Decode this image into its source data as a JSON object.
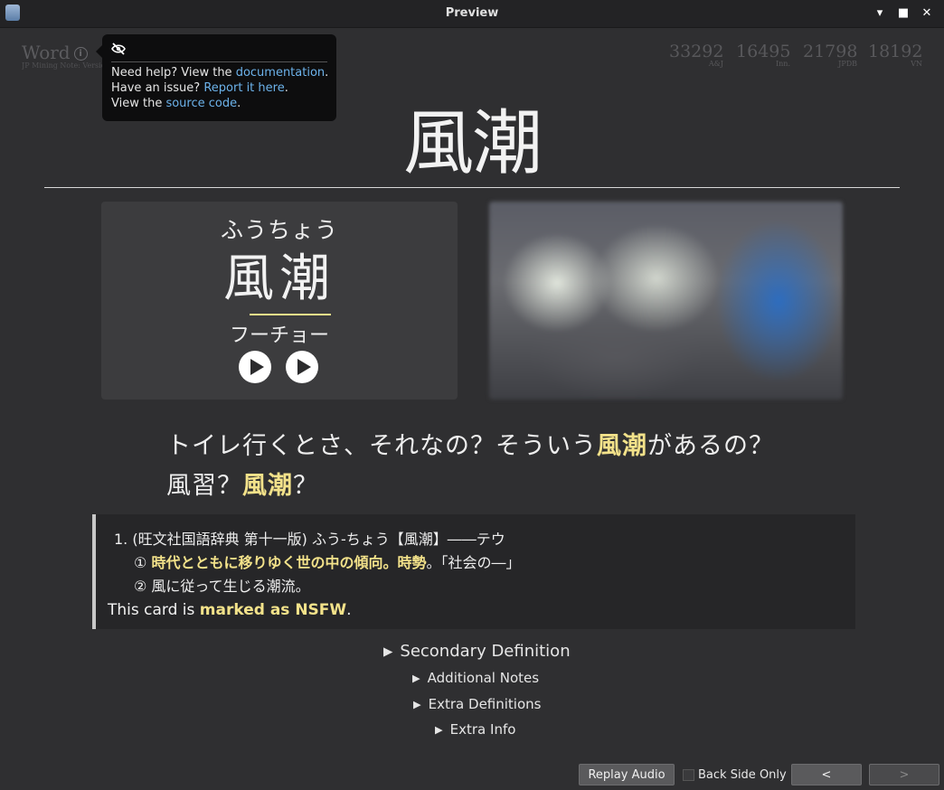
{
  "window": {
    "title": "Preview",
    "controls": [
      "▾",
      "■",
      "✕"
    ]
  },
  "card_header": {
    "word_label": "Word",
    "note_type": "JP Mining Note: Version",
    "tooltip": {
      "line1_prefix": "Need help? View the ",
      "line1_link": "documentation",
      "line1_suffix": ".",
      "line2_prefix": "Have an issue? ",
      "line2_link": "Report it here",
      "line2_suffix": ".",
      "line3_prefix": "View the ",
      "line3_link": "source code",
      "line3_suffix": "."
    },
    "frequencies": [
      {
        "value": "33292",
        "label": "A&J"
      },
      {
        "value": "16495",
        "label": "Inn."
      },
      {
        "value": "21798",
        "label": "JPDB"
      },
      {
        "value": "18192",
        "label": "VN"
      }
    ]
  },
  "word": "風潮",
  "reading": {
    "furigana": "ふうちょう",
    "kanji": "風潮",
    "kana": "フーチョー"
  },
  "sentence": {
    "line1_a": "トイレ行くとさ、それなの？そういう",
    "line1_hl": "風潮",
    "line1_b": "があるの？",
    "line2_a": "風習？",
    "line2_hl": "風潮",
    "line2_b": "？"
  },
  "definition": {
    "header": "1. (旺文社国語辞典 第十一版) ふう‐ちょう【風潮】――テウ",
    "sense1_num": "①",
    "sense1_hl": "時代とともに移りゆく世の中の傾向。時勢",
    "sense1_rest": "。「社会の―」",
    "sense2": "② 風に従って生じる潮流。",
    "nsfw_prefix": "This card is ",
    "nsfw_bold": "marked as NSFW",
    "nsfw_suffix": "."
  },
  "collapsibles": {
    "secondary": "Secondary Definition",
    "notes": "Additional Notes",
    "extra_defs": "Extra Definitions",
    "extra_info": "Extra Info"
  },
  "bottom_bar": {
    "replay": "Replay Audio",
    "back_only": "Back Side Only",
    "prev": "<",
    "next": ">"
  },
  "colors": {
    "highlight": "#f3e28a",
    "link": "#6cb2ea",
    "background": "#2f2f31"
  }
}
